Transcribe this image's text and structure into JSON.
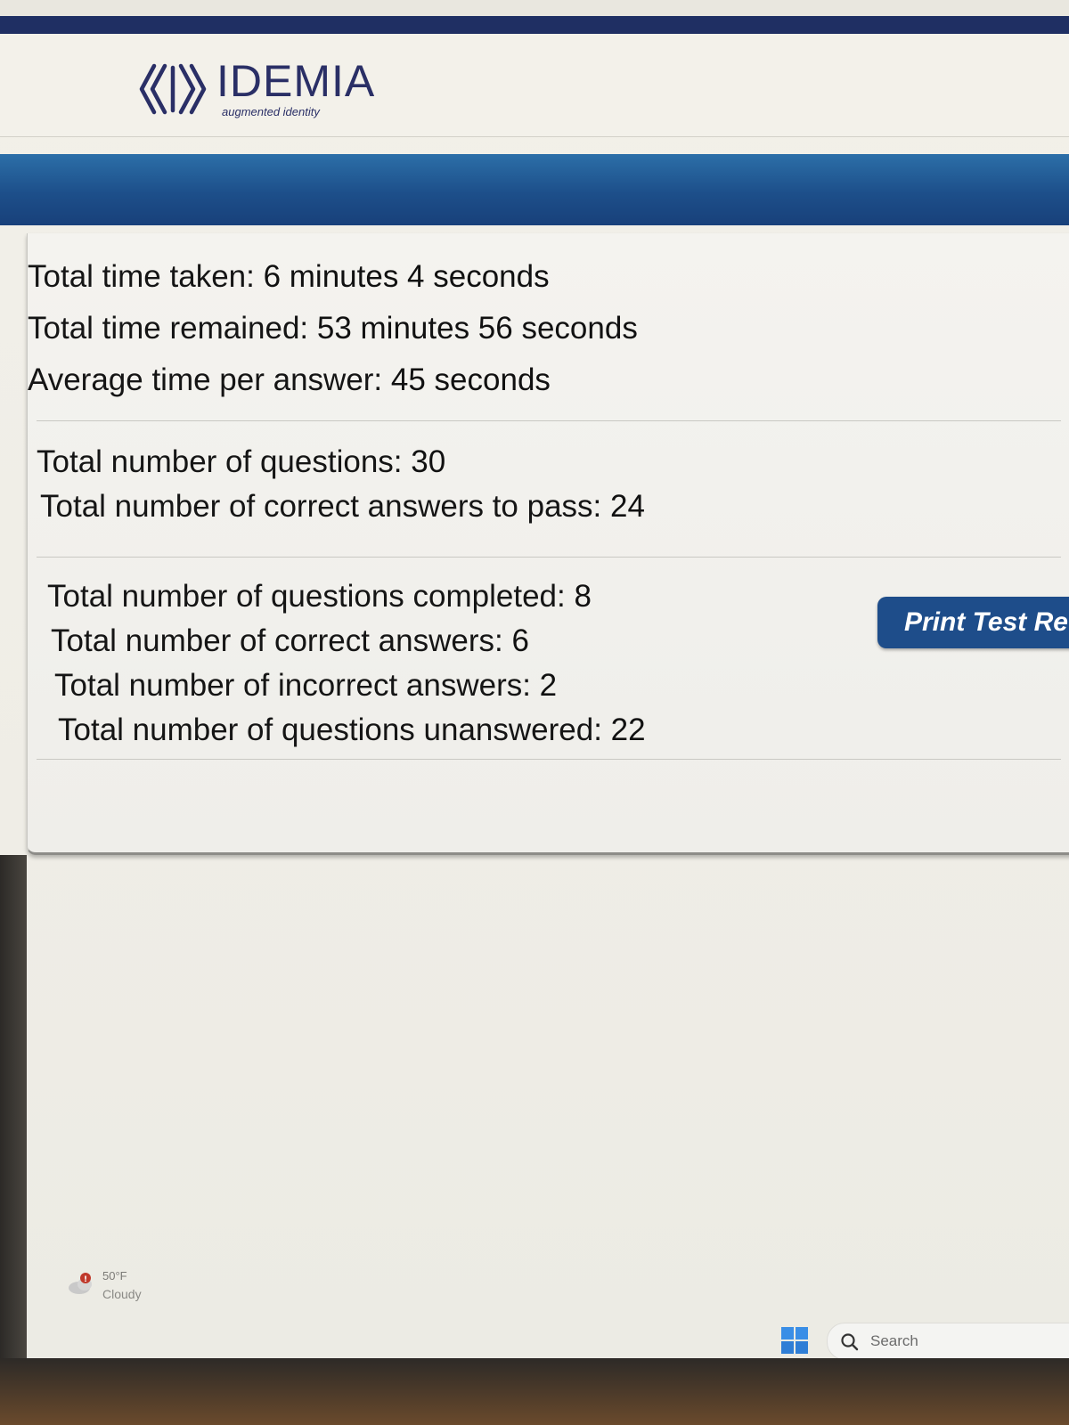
{
  "brand": {
    "name": "IDEMIA",
    "tagline": "augmented identity"
  },
  "colors": {
    "navy": "#1f2f63",
    "band_blue": "#1d4f8a",
    "button_blue": "#1e4d8a"
  },
  "results": {
    "timing": [
      {
        "label": "Total time taken:",
        "value": "6 minutes 4 seconds"
      },
      {
        "label": "Total time remained:",
        "value": "53 minutes 56 seconds"
      },
      {
        "label": "Average time per answer:",
        "value": "45 seconds"
      }
    ],
    "requirements": [
      {
        "label": "Total number of questions:",
        "value": "30"
      },
      {
        "label": "Total number of correct answers to pass:",
        "value": "24"
      }
    ],
    "progress": [
      {
        "label": "Total number of questions completed:",
        "value": "8"
      },
      {
        "label": "Total number of correct answers:",
        "value": "6"
      },
      {
        "label": "Total number of incorrect answers:",
        "value": "2"
      },
      {
        "label": "Total number of questions unanswered:",
        "value": "22"
      }
    ]
  },
  "actions": {
    "print_label": "Print Test Re"
  },
  "taskbar": {
    "weather_temp": "50°F",
    "weather_condition": "Cloudy",
    "search_placeholder": "Search",
    "icons": [
      "weather-cloud-icon",
      "windows-start-icon",
      "search-icon"
    ]
  }
}
